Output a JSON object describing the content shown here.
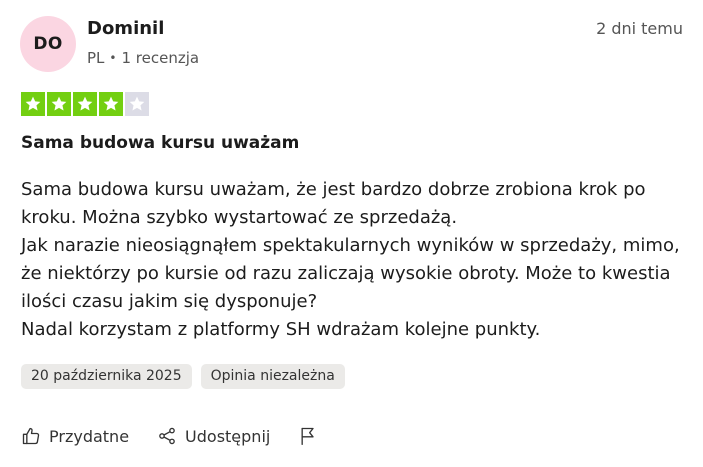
{
  "reviewer": {
    "initials": "DO",
    "name": "Dominil",
    "country": "PL",
    "separator": "•",
    "reviews_count": "1 recenzja",
    "avatar_color": "#fbd6e2"
  },
  "review": {
    "date_relative": "2 dni temu",
    "rating": 4,
    "rating_max": 5,
    "star_filled_color": "#73cf11",
    "star_empty_color": "#dcdce6",
    "title": "Sama budowa kursu uważam",
    "body": [
      "Sama budowa kursu uważam, że jest bardzo dobrze zrobiona krok po kroku. Można szybko wystartować ze sprzedażą.",
      "Jak narazie nieosiągnąłem spektakularnych wyników w sprzedaży, mimo, że niektórzy po kursie od razu zaliczają wysokie obroty. Może to kwestia ilości czasu jakim się dysponuje?",
      "Nadal korzystam z platformy SH wdrażam kolejne punkty."
    ],
    "tags": [
      "20 października 2025",
      "Opinia niezależna"
    ]
  },
  "actions": {
    "helpful_label": "Przydatne",
    "helpful_icon": "thumbs-up-icon",
    "share_label": "Udostępnij",
    "share_icon": "share-icon",
    "report_icon": "flag-icon"
  }
}
